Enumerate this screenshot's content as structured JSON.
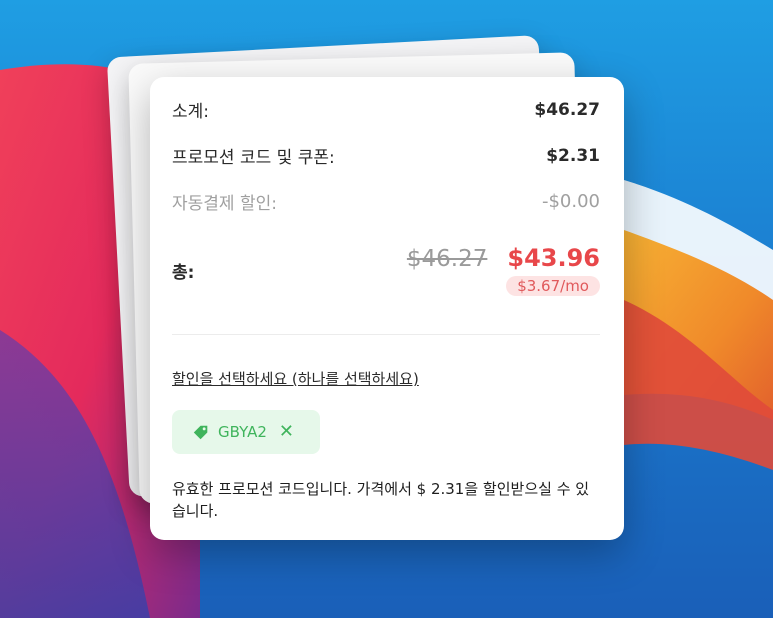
{
  "summary": {
    "subtotal_label": "소계:",
    "subtotal_value": "$46.27",
    "promo_label": "프로모션 코드 및 쿠폰:",
    "promo_value": "$2.31",
    "autopay_label": "자동결제 할인:",
    "autopay_value": "-$0.00",
    "total_label": "총:",
    "original_price": "$46.27",
    "final_price": "$43.96",
    "monthly_price": "$3.67/mo"
  },
  "discount": {
    "select_link": "할인을 선택하세요 (하나를 선택하세요)",
    "coupon_code": "GBYA2",
    "remove_symbol": "✕",
    "message": "유효한 프로모션 코드입니다. 가격에서 $ 2.31을 할인받으실 수 있습니다."
  },
  "colors": {
    "accent_red": "#e8474a",
    "coupon_green": "#3fb45c",
    "coupon_bg": "#e6f8ea"
  },
  "icons": {
    "coupon_tag": "tag-icon",
    "remove": "close-icon"
  }
}
